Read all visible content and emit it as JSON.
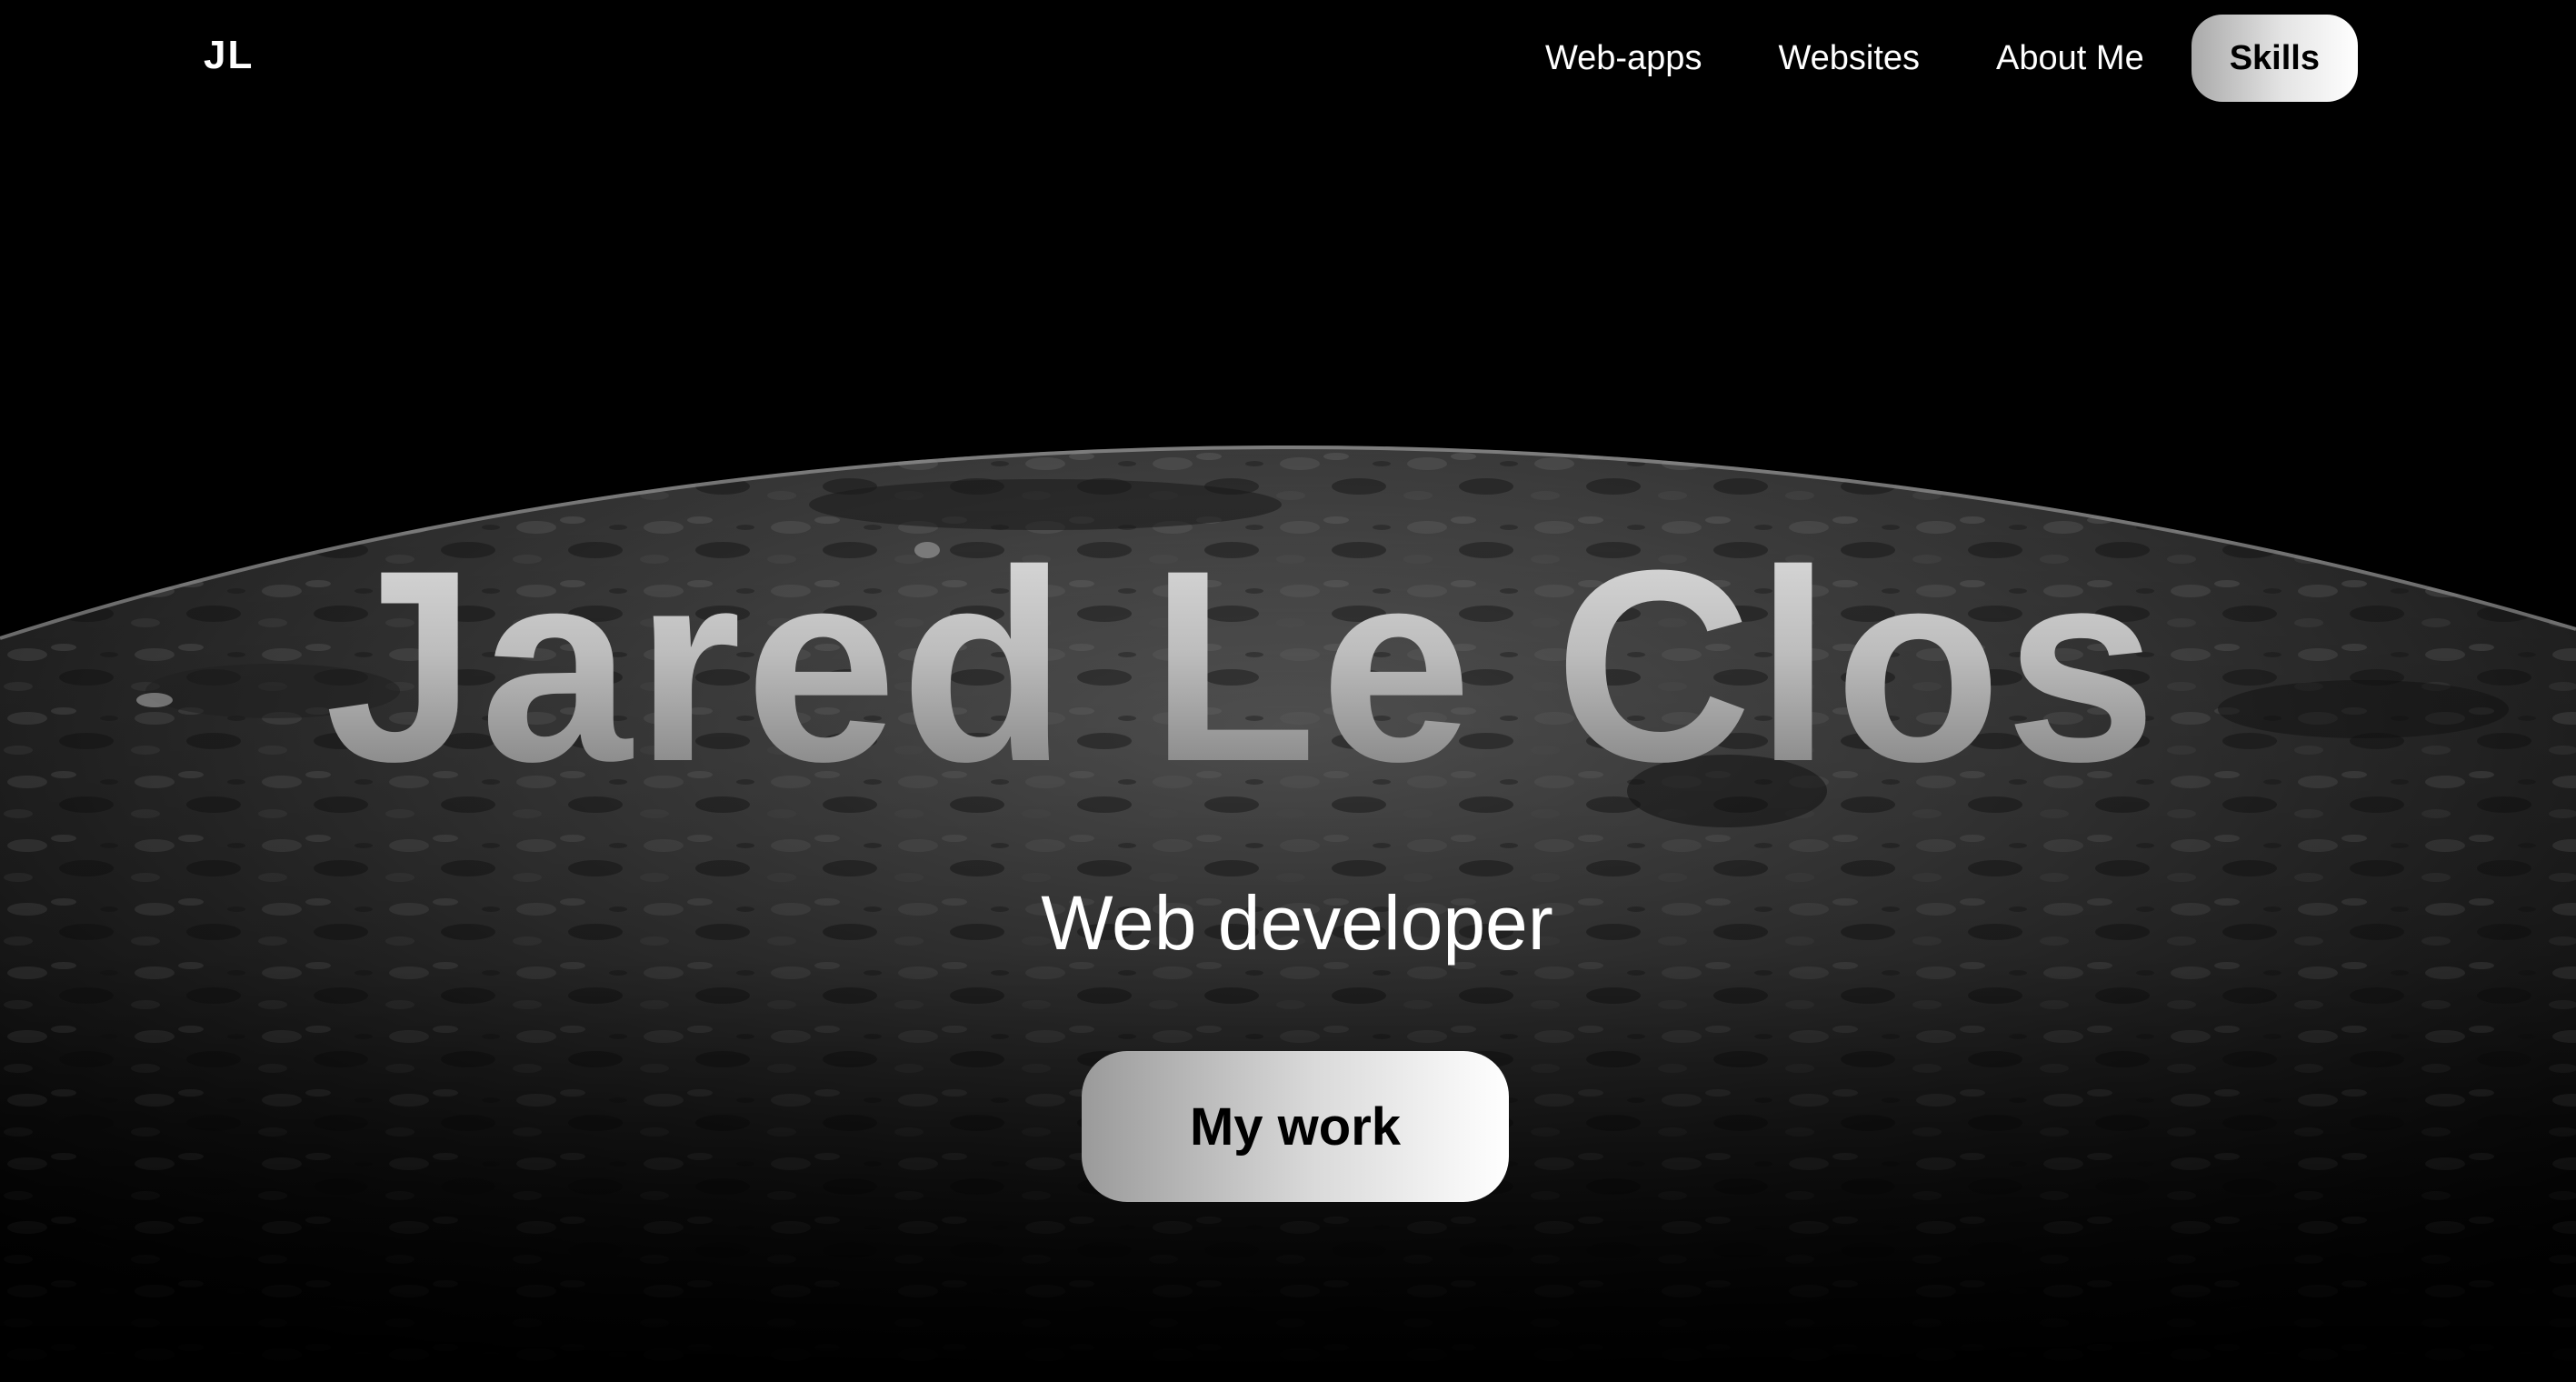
{
  "nav": {
    "logo": "JL",
    "links": [
      {
        "label": "Web-apps"
      },
      {
        "label": "Websites"
      },
      {
        "label": "About Me"
      }
    ],
    "skills_label": "Skills"
  },
  "hero": {
    "title": "Jared Le Clos",
    "subtitle": "Web developer",
    "cta_label": "My work"
  },
  "colors": {
    "background": "#000000",
    "text": "#ffffff",
    "pill_gradient_start": "#a9a9a9",
    "pill_gradient_end": "#ffffff"
  }
}
